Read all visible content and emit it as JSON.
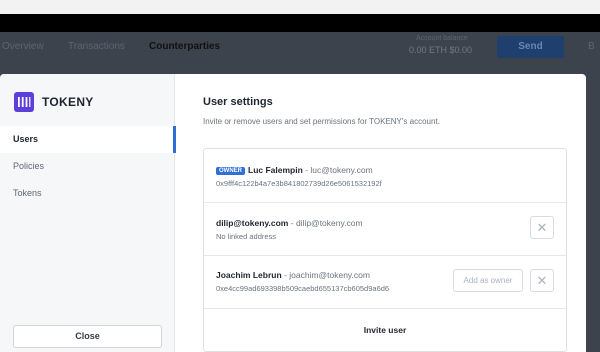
{
  "background_app": {
    "nav": [
      "Overview",
      "Transactions",
      "Counterparties"
    ],
    "active_nav": "Counterparties",
    "balance_label": "Account balance",
    "balance_value": "0.00 ETH $0.00",
    "send_label": "Send",
    "right_label": "B"
  },
  "sidebar": {
    "brand": "TOKENY",
    "items": [
      {
        "label": "Users",
        "active": true
      },
      {
        "label": "Policies",
        "active": false
      },
      {
        "label": "Tokens",
        "active": false
      }
    ],
    "close_label": "Close"
  },
  "settings": {
    "title": "User settings",
    "subtitle": "Invite or remove users and set permissions for TOKENY's account."
  },
  "users": [
    {
      "badge": "OWNER",
      "name": "Luc Falempin",
      "email": "- luc@tokeny.com",
      "address": "0x9fff4c122b4a7e3b841802739d26e5061532192f"
    },
    {
      "name": "dilip@tokeny.com",
      "email": "- dilip@tokeny.com",
      "address": "No linked address",
      "remove_icon": "close-icon"
    },
    {
      "name": "Joachim Lebrun",
      "email": "- joachim@tokeny.com",
      "address": "0xe4cc99ad693398b509caebd655137cb605d9a6d6",
      "owner_action": "Add as owner",
      "remove_icon": "close-icon"
    }
  ],
  "invite_label": "Invite user",
  "colors": {
    "accent": "#2f6fd6",
    "backdrop": "#3d434d",
    "send_button": "#1f3f6e"
  }
}
